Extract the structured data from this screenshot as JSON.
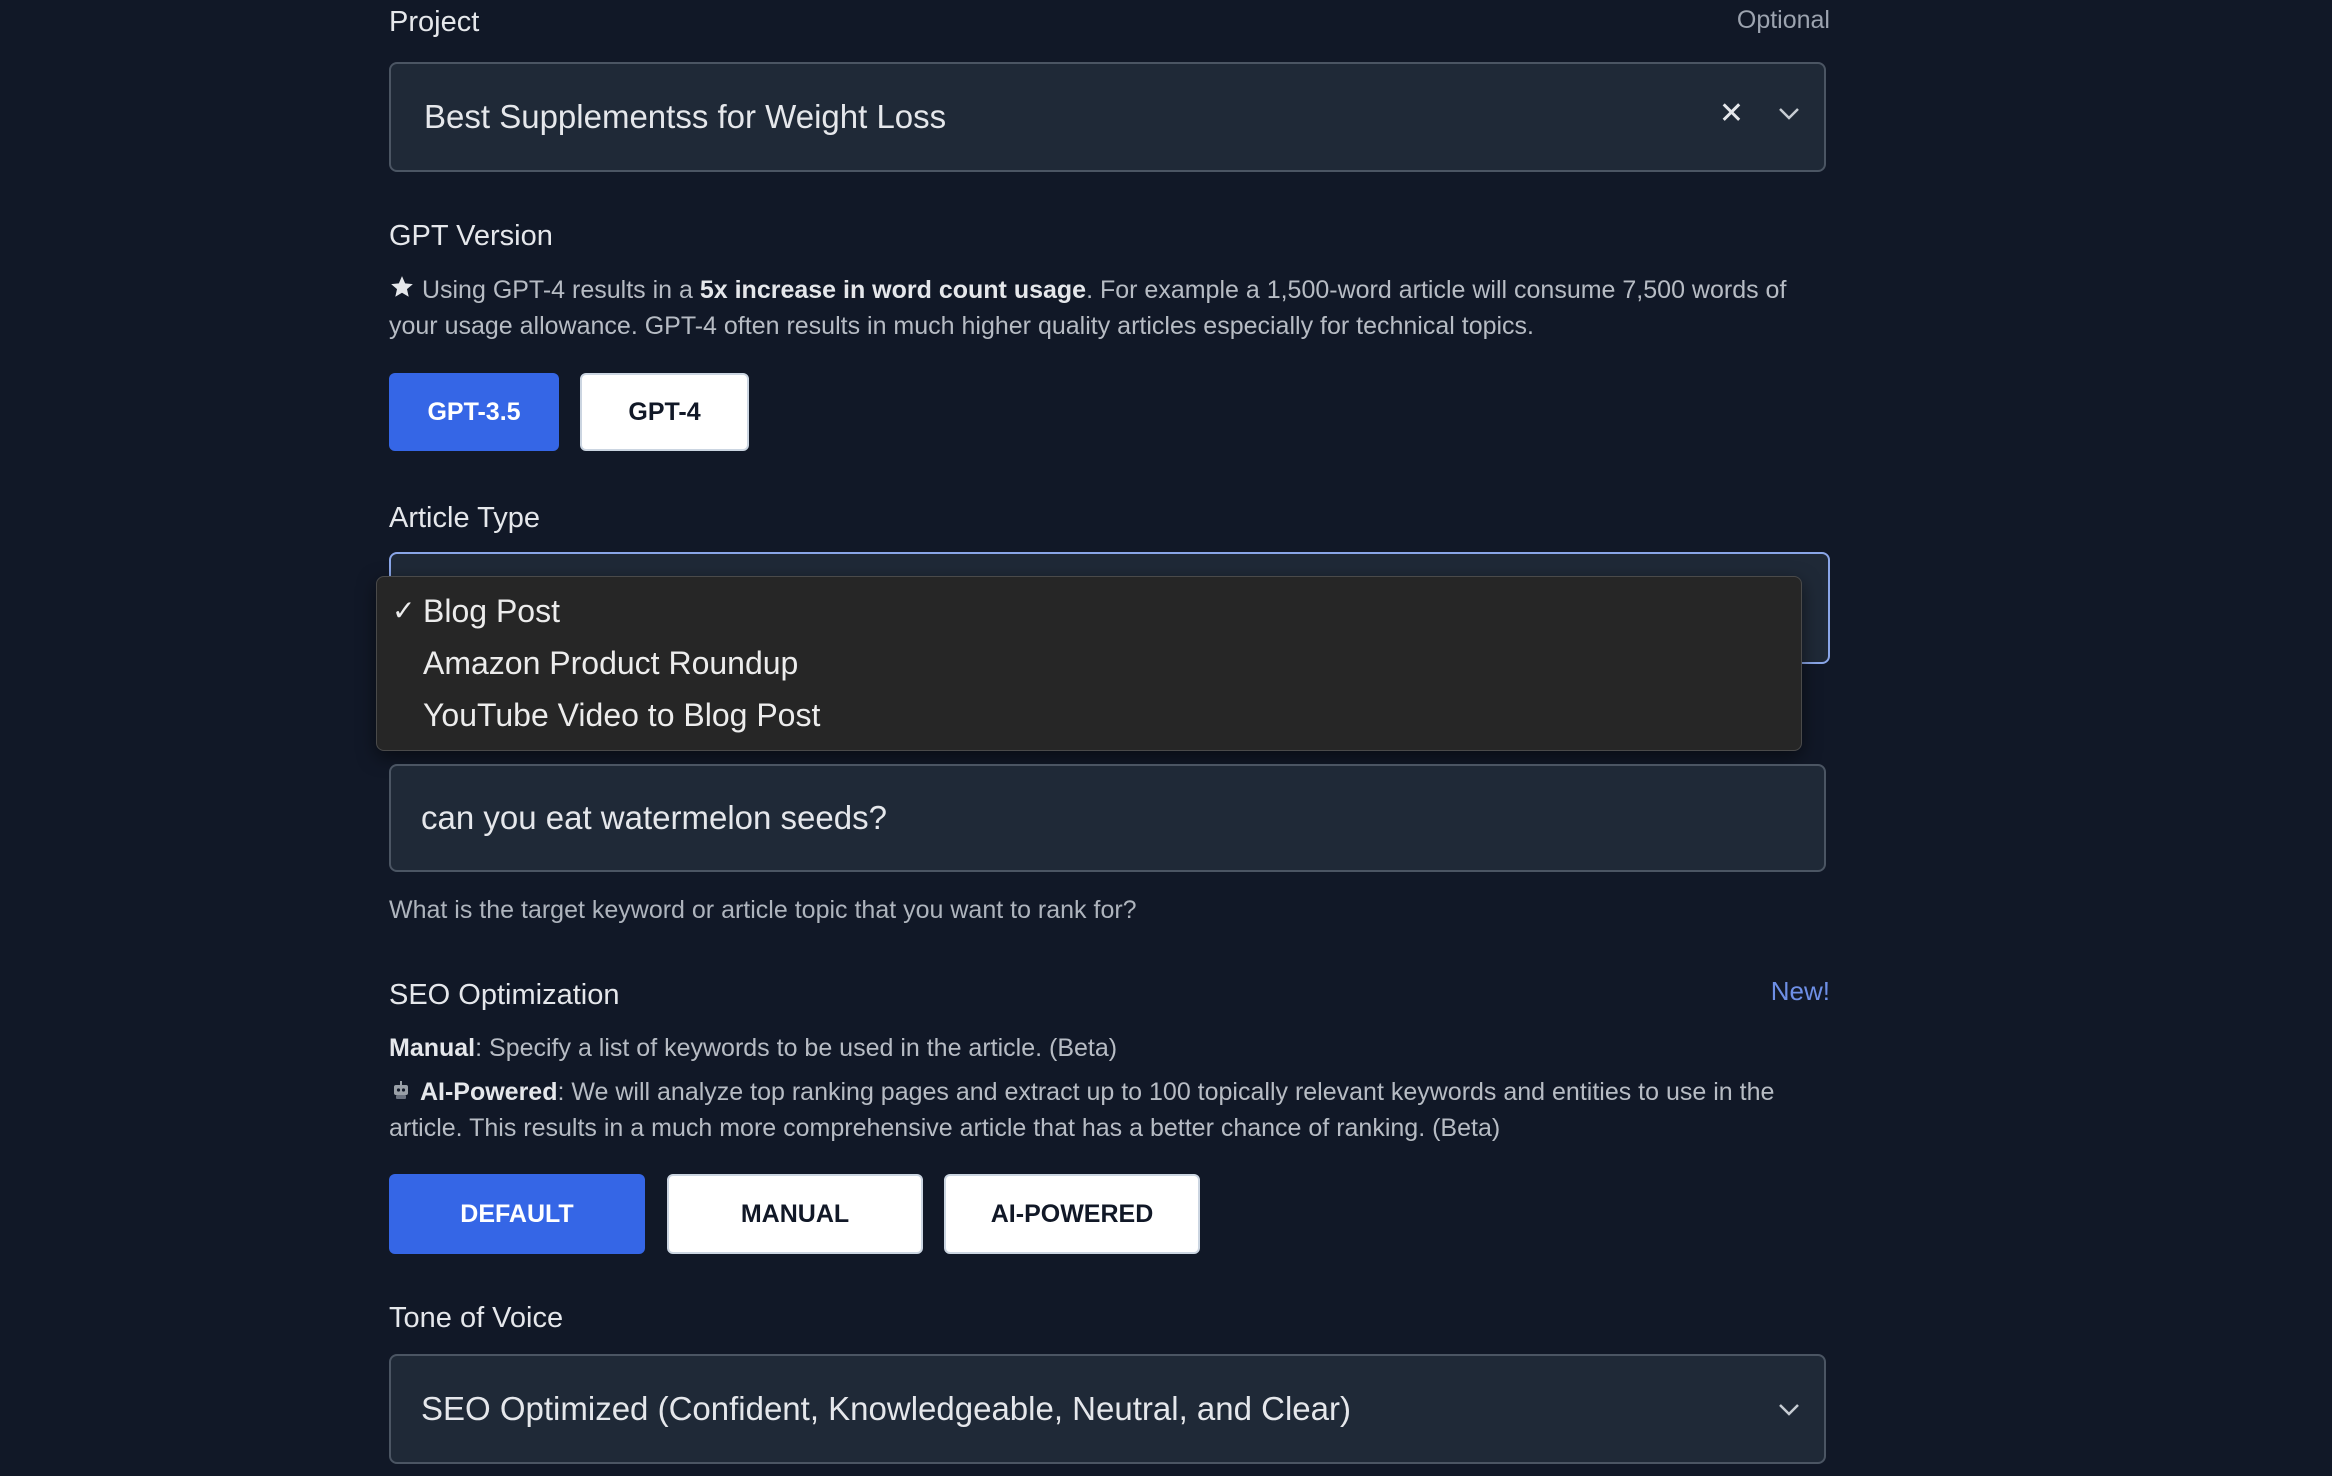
{
  "project": {
    "label": "Project",
    "optional": "Optional",
    "value": "Best Supplementss for Weight Loss"
  },
  "gpt": {
    "label": "GPT Version",
    "desc_pre": "Using GPT-4 results in a ",
    "desc_bold": "5x increase in word count usage",
    "desc_post": ". For example a 1,500-word article will consume 7,500 words of your usage allowance. GPT-4 often results in much higher quality articles especially for technical topics.",
    "options": [
      "GPT-3.5",
      "GPT-4"
    ],
    "selected": "GPT-3.5"
  },
  "article_type": {
    "label": "Article Type",
    "options": [
      "Blog Post",
      "Amazon Product Roundup",
      "YouTube Video to Blog Post"
    ],
    "selected": "Blog Post"
  },
  "topic": {
    "value": "can you eat watermelon seeds?",
    "helper": "What is the target keyword or article topic that you want to rank for?"
  },
  "seo": {
    "label": "SEO Optimization",
    "badge": "New!",
    "manual_bold": "Manual",
    "manual_text": ": Specify a list of keywords to be used in the article. (Beta)",
    "ai_bold": "AI-Powered",
    "ai_text": ": We will analyze top ranking pages and extract up to 100 topically relevant keywords and entities to use in the article. This results in a much more comprehensive article that has a better chance of ranking. (Beta)",
    "options": [
      "DEFAULT",
      "MANUAL",
      "AI-POWERED"
    ],
    "selected": "DEFAULT"
  },
  "tone": {
    "label": "Tone of Voice",
    "value": "SEO Optimized (Confident, Knowledgeable, Neutral, and Clear)"
  },
  "colors": {
    "background": "#111827",
    "field": "#1f2937",
    "accent": "#3566e6",
    "new_badge": "#6e8fe6"
  }
}
